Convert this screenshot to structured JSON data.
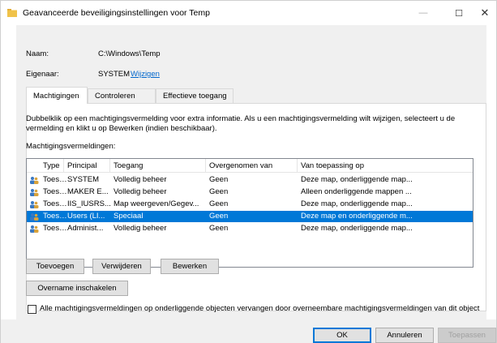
{
  "window": {
    "title": "Geavanceerde beveiligingsinstellingen voor Temp",
    "minimize_glyph": "—",
    "maximize_glyph": "☐",
    "close_glyph": "✕"
  },
  "header": {
    "name_label": "Naam:",
    "name_value": "C:\\Windows\\Temp",
    "owner_label": "Eigenaar:",
    "owner_value": "SYSTEM",
    "owner_change_link": "Wijzigen"
  },
  "tabs": [
    {
      "label": "Machtigingen",
      "active": true
    },
    {
      "label": "Controleren",
      "active": false
    },
    {
      "label": "Effectieve toegang",
      "active": false
    }
  ],
  "description": "Dubbelklik op een machtigingsvermelding voor extra informatie. Als u een machtigingsvermelding wilt wijzigen, selecteert u de vermelding en klikt u op Bewerken (indien beschikbaar).",
  "permissions": {
    "label": "Machtigingsvermeldingen:",
    "columns": [
      "Type",
      "Principal",
      "Toegang",
      "Overgenomen van",
      "Van toepassing op"
    ],
    "rows": [
      {
        "type": "Toesta...",
        "principal": "SYSTEM",
        "access": "Volledig beheer",
        "inherited": "Geen",
        "applies": "Deze map, onderliggende map...",
        "selected": false
      },
      {
        "type": "Toesta...",
        "principal": "MAKER E...",
        "access": "Volledig beheer",
        "inherited": "Geen",
        "applies": "Alleen onderliggende mappen ...",
        "selected": false
      },
      {
        "type": "Toesta...",
        "principal": "IIS_IUSRS...",
        "access": "Map weergeven/Gegev...",
        "inherited": "Geen",
        "applies": "Deze map, onderliggende map...",
        "selected": false
      },
      {
        "type": "Toesta...",
        "principal": "Users (LI...",
        "access": "Speciaal",
        "inherited": "Geen",
        "applies": "Deze map en onderliggende m...",
        "selected": true
      },
      {
        "type": "Toesta...",
        "principal": "Administ...",
        "access": "Volledig beheer",
        "inherited": "Geen",
        "applies": "Deze map, onderliggende map...",
        "selected": false
      }
    ]
  },
  "buttons": {
    "add": "Toevoegen",
    "remove": "Verwijderen",
    "edit": "Bewerken",
    "enable_inheritance": "Overname inschakelen",
    "ok": "OK",
    "cancel": "Annuleren",
    "apply": "Toepassen"
  },
  "replace_checkbox": {
    "label": "Alle machtigingsvermeldingen op onderliggende objecten vervangen door overneembare machtigingsvermeldingen van dit object",
    "checked": false
  },
  "colors": {
    "selection": "#0078d7",
    "link": "#0066cc",
    "folder": "#f0c24a"
  },
  "icons": {
    "title": "folder-icon",
    "row": "users-icon"
  }
}
